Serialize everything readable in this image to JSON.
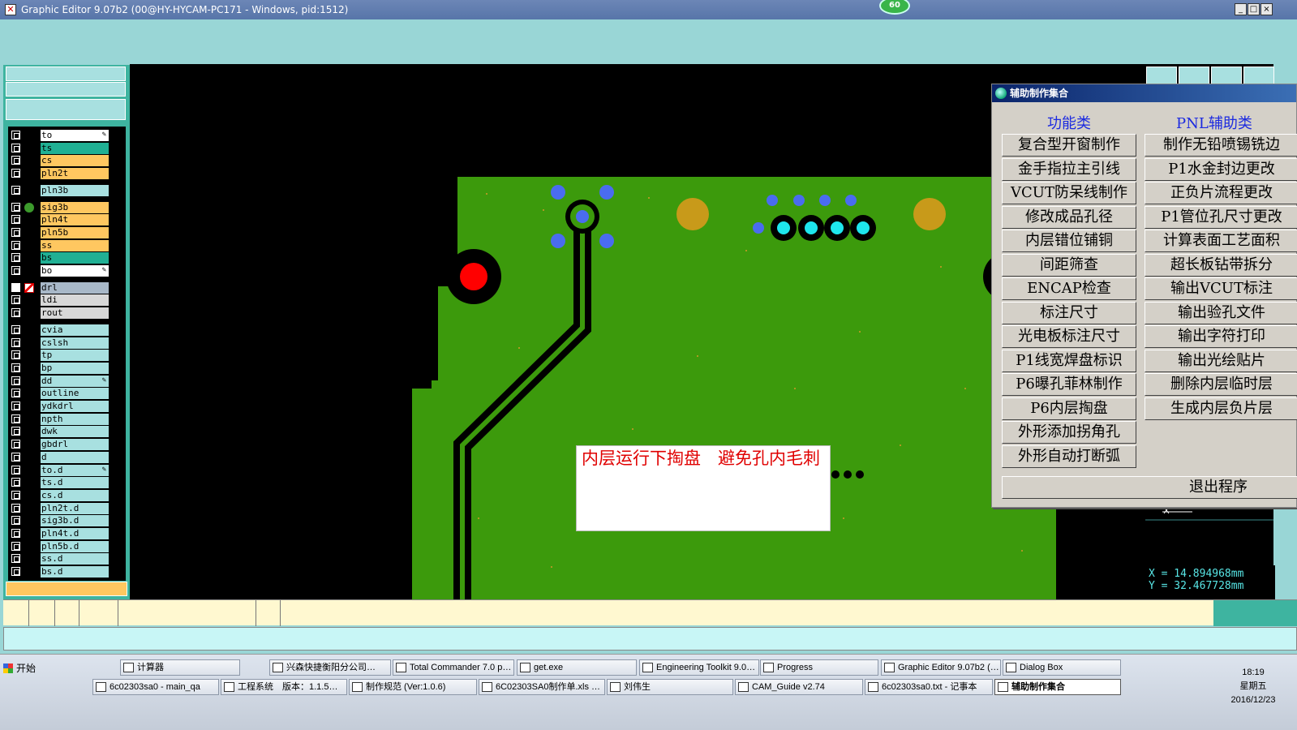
{
  "window": {
    "title": "Graphic Editor 9.07b2 (00@HY-HYCAM-PC171 - Windows, pid:1512)",
    "badge": "60",
    "controls": [
      "_",
      "□",
      "×"
    ]
  },
  "layers": [
    {
      "name": "to",
      "color": "#ffffff",
      "edit": true
    },
    {
      "name": "ts",
      "color": "#20b094"
    },
    {
      "name": "cs",
      "color": "#ffc760"
    },
    {
      "name": "pln2t",
      "color": "#ffc760"
    },
    {
      "name": "pln3b",
      "color": "#a8e0e0"
    },
    {
      "name": "sig3b",
      "color": "#ffc760",
      "marker": "green-dot"
    },
    {
      "name": "pln4t",
      "color": "#ffc760"
    },
    {
      "name": "pln5b",
      "color": "#ffc760"
    },
    {
      "name": "ss",
      "color": "#ffc760"
    },
    {
      "name": "bs",
      "color": "#20b094"
    },
    {
      "name": "bo",
      "color": "#ffffff",
      "edit": true
    },
    {
      "name": "drl",
      "color": "#a8b8c8",
      "marker": "red-cursor",
      "checked": true
    },
    {
      "name": "ldi",
      "color": "#d8d8d8"
    },
    {
      "name": "rout",
      "color": "#d8d8d8"
    },
    {
      "name": "cvia",
      "color": "#a8e0e0"
    },
    {
      "name": "cslsh",
      "color": "#a8e0e0"
    },
    {
      "name": "tp",
      "color": "#a8e0e0"
    },
    {
      "name": "bp",
      "color": "#a8e0e0"
    },
    {
      "name": "dd",
      "color": "#a8e0e0",
      "edit": true
    },
    {
      "name": "outline",
      "color": "#a8e0e0"
    },
    {
      "name": "ydkdrl",
      "color": "#a8e0e0"
    },
    {
      "name": "npth",
      "color": "#a8e0e0"
    },
    {
      "name": "dwk",
      "color": "#a8e0e0"
    },
    {
      "name": "gbdrl",
      "color": "#a8e0e0"
    },
    {
      "name": "d",
      "color": "#a8e0e0"
    },
    {
      "name": "to.d",
      "color": "#a8e0e0",
      "edit": true
    },
    {
      "name": "ts.d",
      "color": "#a8e0e0"
    },
    {
      "name": "cs.d",
      "color": "#a8e0e0"
    },
    {
      "name": "pln2t.d",
      "color": "#a8e0e0"
    },
    {
      "name": "sig3b.d",
      "color": "#a8e0e0"
    },
    {
      "name": "pln4t.d",
      "color": "#a8e0e0"
    },
    {
      "name": "pln5b.d",
      "color": "#a8e0e0"
    },
    {
      "name": "ss.d",
      "color": "#a8e0e0"
    },
    {
      "name": "bs.d",
      "color": "#a8e0e0"
    }
  ],
  "coords": {
    "x": "X = 14.894968mm",
    "y": "Y = 32.467728mm"
  },
  "annotation": "内层运行下掏盘　避免孔内毛刺",
  "dialog": {
    "title": "辅助制作集合",
    "left_category": "功能类",
    "right_category": "PNL辅助类",
    "left_buttons": [
      "复合型开窗制作",
      "金手指拉主引线",
      "VCUT防呆线制作",
      "修改成品孔径",
      "内层错位铺铜",
      "间距筛查",
      "ENCAP检查",
      "标注尺寸",
      "光电板标注尺寸",
      "P1线宽焊盘标识",
      "P6曝孔菲林制作",
      "P6内层掏盘",
      "外形添加拐角孔",
      "外形自动打断弧"
    ],
    "right_buttons": [
      "制作无铅喷锡铣边",
      "P1水金封边更改",
      "正负片流程更改",
      "P1管位孔尺寸更改",
      "计算表面工艺面积",
      "超长板钻带拆分",
      "输出VCUT标注",
      "输出验孔文件",
      "输出字符打印",
      "输出光绘贴片",
      "删除内层临时层",
      "生成内层负片层"
    ],
    "exit_button": "退出程序"
  },
  "taskbar": {
    "start": "开始",
    "row1": [
      "计算器",
      "兴森快捷衡阳分公司…",
      "Total Commander 7.0 p…",
      "get.exe",
      "Engineering Toolkit 9.0…",
      "Progress",
      "Graphic Editor 9.07b2 (…",
      "Dialog Box"
    ],
    "row2": [
      "6c02303sa0 - main_qa",
      "工程系统　版本：1.1.5…",
      "制作规范 (Ver:1.0.6)",
      "6C02303SA0制作单.xls …",
      "刘伟生",
      "CAM_Guide v2.74",
      "6c02303sa0.txt - 记事本",
      "辅助制作集合"
    ],
    "time": "18:19",
    "weekday": "星期五",
    "date": "2016/12/23"
  }
}
